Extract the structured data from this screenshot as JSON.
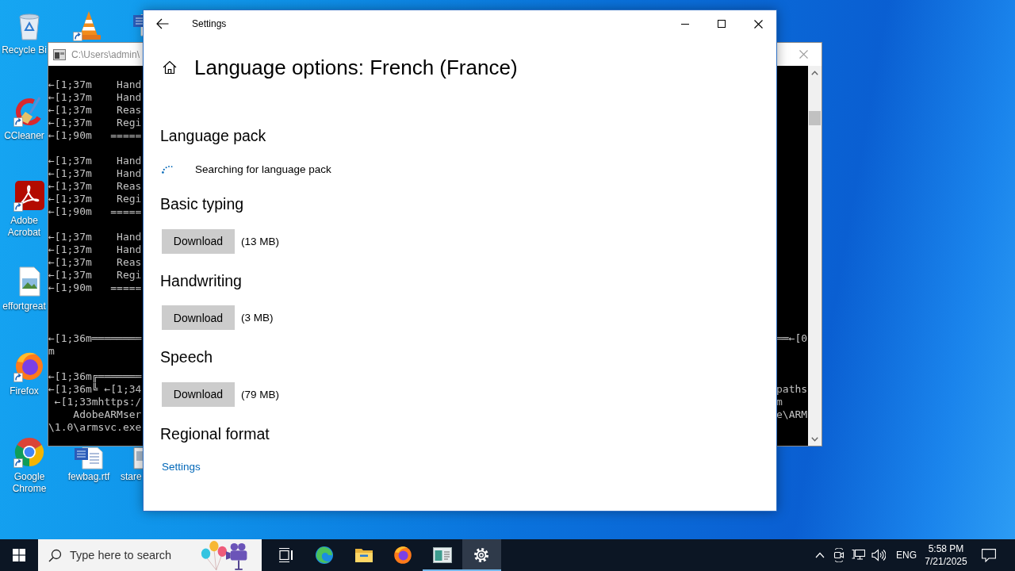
{
  "desktop": {
    "icons": [
      {
        "kind": "recycle-bin",
        "label": "Recycle Bi",
        "shortcut": false
      },
      {
        "kind": "cleaner",
        "label": "CCleaner",
        "shortcut": true
      },
      {
        "kind": "pdf",
        "label": "Adobe Acrobat",
        "shortcut": true
      },
      {
        "kind": "image-file",
        "label": "effortgreat",
        "shortcut": false
      },
      {
        "kind": "firefox",
        "label": "Firefox",
        "shortcut": true
      },
      {
        "kind": "chrome",
        "label": "Google Chrome",
        "shortcut": true
      },
      {
        "kind": "vlc",
        "shortcut": true
      },
      {
        "kind": "word-file",
        "label": "fewbag.rtf",
        "shortcut": false
      },
      {
        "kind": "word-file",
        "shortcut": false
      },
      {
        "kind": "file",
        "label": "stare",
        "shortcut": false
      }
    ]
  },
  "console_window": {
    "title": "C:\\Users\\admin\\",
    "blocks": [
      {
        "lines": [
          {
            "left": "←[1;37m    Hand"
          },
          {
            "left": "←[1;37m    Hand"
          },
          {
            "left": "←[1;37m    Reas"
          },
          {
            "left": "←[1;37m    Regi"
          },
          {
            "left": "←[1;90m   ====="
          }
        ]
      },
      {
        "lines": [
          {
            "left": "←[1;37m    Hand"
          },
          {
            "left": "←[1;37m    Hand"
          },
          {
            "left": "←[1;37m    Reas"
          },
          {
            "left": "←[1;37m    Regi"
          },
          {
            "left": "←[1;90m   ====="
          }
        ]
      },
      {
        "lines": [
          {
            "left": "←[1;37m    Hand"
          },
          {
            "left": "←[1;37m    Hand"
          },
          {
            "left": "←[1;37m    Reas"
          },
          {
            "left": "←[1;37m    Regi"
          },
          {
            "left": "←[1;90m   ====="
          }
        ]
      },
      {
        "lines": [
          {
            "left": "←[1;36m════════",
            "right": "══←[0"
          },
          {
            "left": "m"
          }
        ]
      },
      {
        "lines": [
          {
            "left": "←[1;36m╔═══════"
          },
          {
            "left": "←[1;36m╚ ←[1;34",
            "right": "paths"
          },
          {
            "left": " ←[1;33mhttps:/",
            "right": "m"
          },
          {
            "left": "    AdobeARMser",
            "right": "e\\ARM"
          },
          {
            "left": "\\1.0\\armsvc.exe"
          }
        ]
      }
    ]
  },
  "settings_window": {
    "title": "Settings",
    "page_title": "Language options: French (France)",
    "sections": [
      {
        "kind": "status",
        "heading": "Language pack",
        "status": "Searching for language pack"
      },
      {
        "kind": "download",
        "heading": "Basic typing",
        "button": "Download",
        "size": "(13 MB)"
      },
      {
        "kind": "download",
        "heading": "Handwriting",
        "button": "Download",
        "size": "(3 MB)"
      },
      {
        "kind": "download",
        "heading": "Speech",
        "button": "Download",
        "size": "(79 MB)"
      },
      {
        "kind": "link",
        "heading": "Regional format",
        "link": "Settings"
      }
    ]
  },
  "taskbar": {
    "search": {
      "placeholder": "Type here to search"
    },
    "apps": [
      {
        "kind": "task-view",
        "running": false,
        "selected": false
      },
      {
        "kind": "edge",
        "running": false,
        "selected": false
      },
      {
        "kind": "explorer",
        "running": false,
        "selected": false
      },
      {
        "kind": "firefox",
        "running": false,
        "selected": false
      },
      {
        "kind": "console",
        "running": true,
        "selected": false
      },
      {
        "kind": "settings",
        "running": true,
        "selected": true
      }
    ],
    "tray": {
      "language": "ENG",
      "time": "5:58 PM",
      "date": "7/21/2025"
    }
  }
}
